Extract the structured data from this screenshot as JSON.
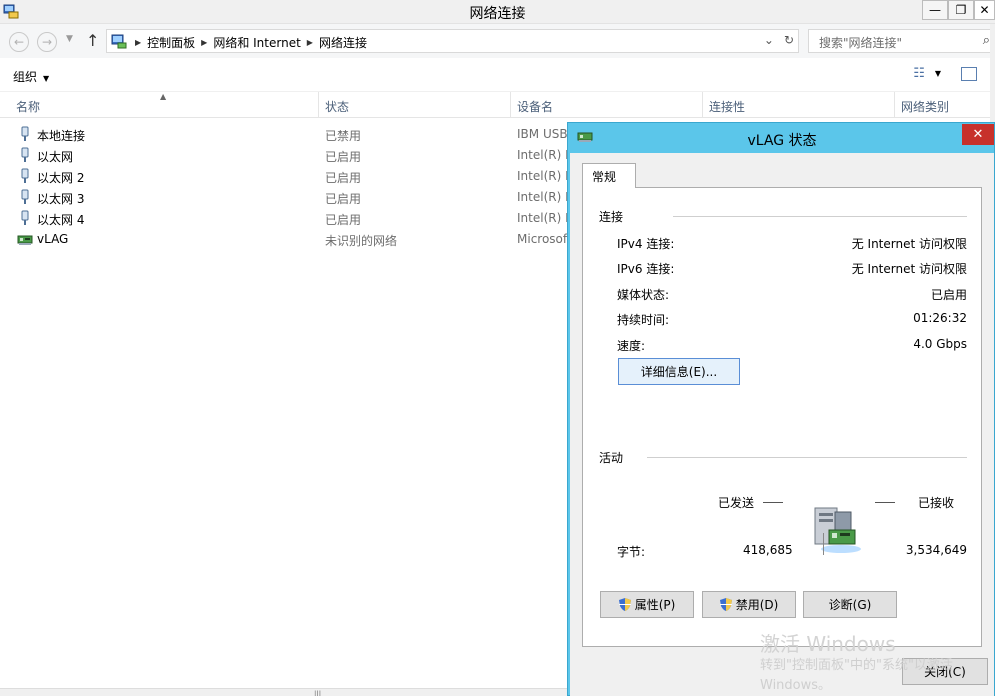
{
  "window": {
    "title": "网络连接",
    "min_glyph": "—",
    "restore_glyph": "❐",
    "close_glyph": "✕"
  },
  "address": {
    "crumbs": [
      "控制面板",
      "网络和 Internet",
      "网络连接"
    ],
    "search_placeholder": "搜索\"网络连接\""
  },
  "toolbar": {
    "organize_label": "组织"
  },
  "columns": {
    "name": "名称",
    "status": "状态",
    "device": "设备名",
    "connectivity": "连接性",
    "network_category": "网络类别"
  },
  "connections": [
    {
      "name": "本地连接",
      "status": "已禁用",
      "device": "IBM USB"
    },
    {
      "name": "以太网",
      "status": "已启用",
      "device": "Intel(R) I"
    },
    {
      "name": "以太网 2",
      "status": "已启用",
      "device": "Intel(R) I"
    },
    {
      "name": "以太网 3",
      "status": "已启用",
      "device": "Intel(R) I"
    },
    {
      "name": "以太网 4",
      "status": "已启用",
      "device": "Intel(R) I"
    },
    {
      "name": "vLAG",
      "status": "未识别的网络",
      "device": "Microsof"
    }
  ],
  "dialog": {
    "title": "vLAG 状态",
    "tab_general": "常规",
    "connection_group": "连接",
    "ipv4_label": "IPv4 连接:",
    "ipv4_value": "无 Internet 访问权限",
    "ipv6_label": "IPv6 连接:",
    "ipv6_value": "无 Internet 访问权限",
    "media_label": "媒体状态:",
    "media_value": "已启用",
    "duration_label": "持续时间:",
    "duration_value": "01:26:32",
    "speed_label": "速度:",
    "speed_value": "4.0 Gbps",
    "details_button": "详细信息(E)...",
    "activity_group": "活动",
    "sent_label": "已发送",
    "received_label": "已接收",
    "bytes_label": "字节:",
    "bytes_sent": "418,685",
    "bytes_received": "3,534,649",
    "properties_button": "属性(P)",
    "disable_button": "禁用(D)",
    "diagnose_button": "诊断(G)",
    "close_button": "关闭(C)"
  },
  "watermark": {
    "line1": "激活 Windows",
    "line2": "转到\"控制面板\"中的\"系统\"以激活 Windows。"
  },
  "colors": {
    "dialog_frame": "#5bc6ea",
    "close_red": "#c7312b",
    "header_text": "#4c607a"
  }
}
